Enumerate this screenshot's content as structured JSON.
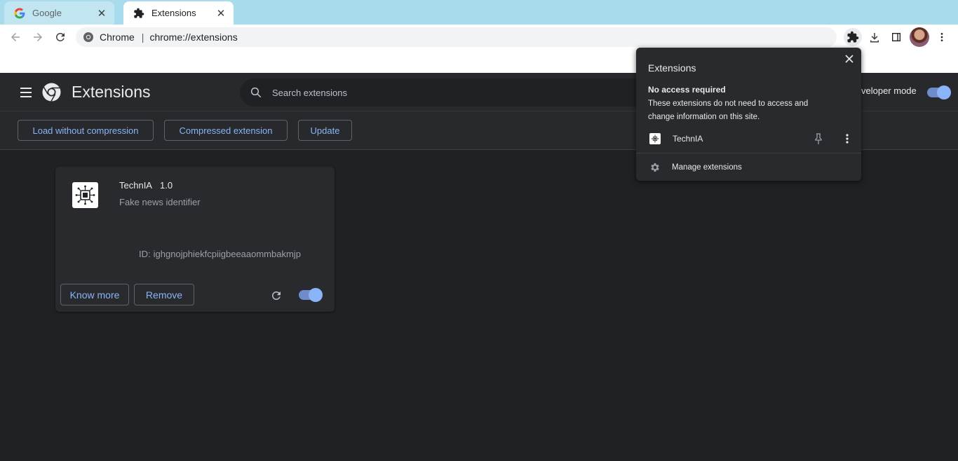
{
  "tabs": [
    {
      "title": "Google",
      "icon": "google-icon",
      "active": false
    },
    {
      "title": "Extensions",
      "icon": "puzzle-icon",
      "active": true
    }
  ],
  "omnibox": {
    "scheme": "Chrome",
    "url": "chrome://extensions"
  },
  "extensions_page": {
    "title": "Extensions",
    "search_placeholder": "Search extensions",
    "developer_mode_label": "veloper mode",
    "developer_mode": true,
    "actions": [
      "Load without compression",
      "Compressed extension",
      "Update"
    ]
  },
  "extension_card": {
    "name": "TechnIA",
    "version": "1.0",
    "description": "Fake news identifier",
    "id_label": "ID:",
    "id": "ighgnojphiekfcpiigbeeaaommbakmjp",
    "know_more_label": "Know more",
    "remove_label": "Remove",
    "enabled": true
  },
  "popup": {
    "title": "Extensions",
    "section_title": "No access required",
    "section_text": "These extensions do not need to access and change information on this site.",
    "item_name": "TechnIA",
    "manage_label": "Manage extensions"
  },
  "colors": {
    "accent": "#8ab4f8",
    "page_bg": "#202124",
    "tabstrip_bg": "#a8dced"
  }
}
